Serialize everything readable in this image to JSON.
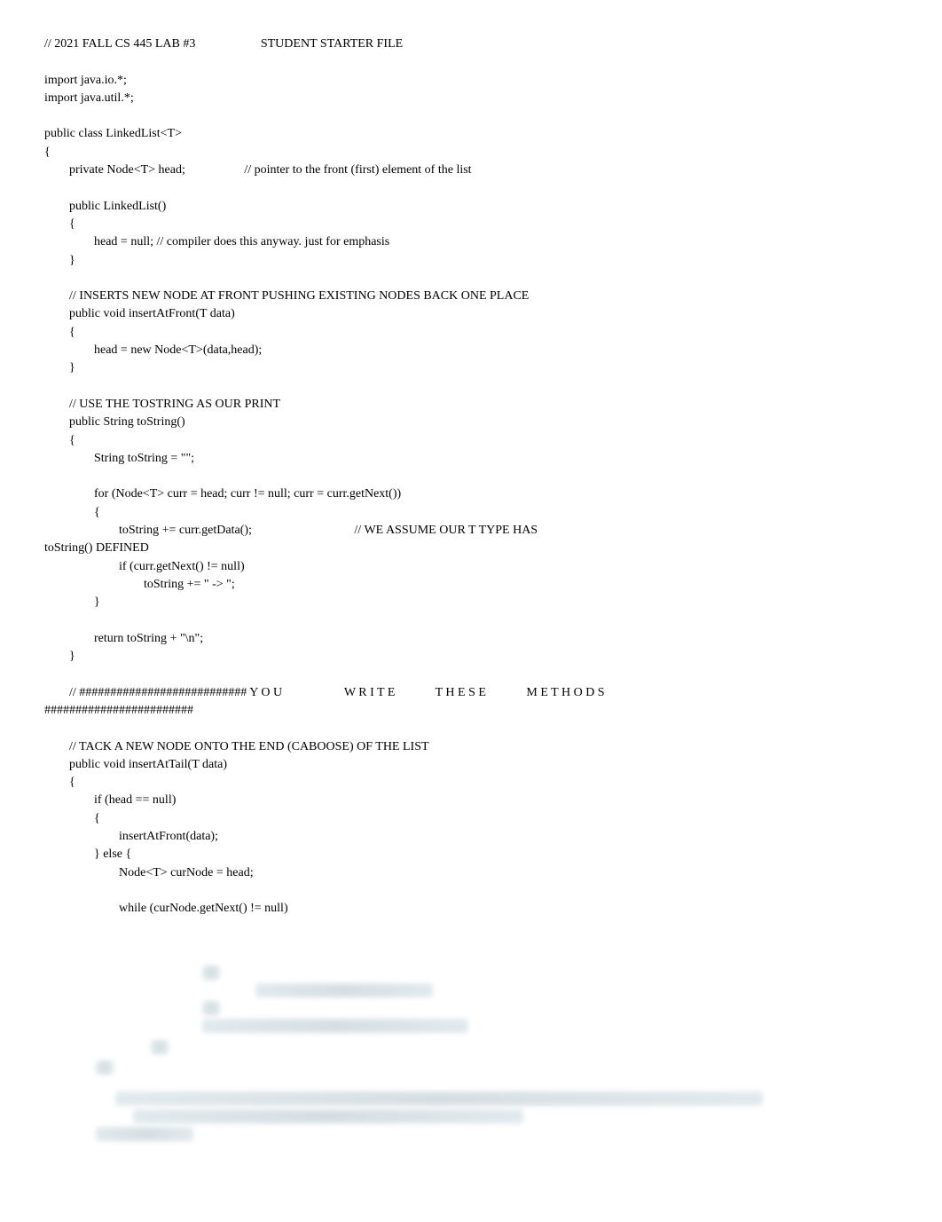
{
  "lines": [
    "// 2021 FALL CS 445 LAB #3                     STUDENT STARTER FILE",
    "",
    "import java.io.*;",
    "import java.util.*;",
    "",
    "public class LinkedList<T>",
    "{",
    "        private Node<T> head;                   // pointer to the front (first) element of the list",
    "",
    "        public LinkedList()",
    "        {",
    "                head = null; // compiler does this anyway. just for emphasis",
    "        }",
    "",
    "        // INSERTS NEW NODE AT FRONT PUSHING EXISTING NODES BACK ONE PLACE",
    "        public void insertAtFront(T data)",
    "        {",
    "                head = new Node<T>(data,head);",
    "        }",
    "",
    "        // USE THE TOSTRING AS OUR PRINT",
    "        public String toString()",
    "        {",
    "                String toString = \"\";",
    "",
    "                for (Node<T> curr = head; curr != null; curr = curr.getNext())",
    "                {",
    "                        toString += curr.getData();                                 // WE ASSUME OUR T TYPE HAS",
    "toString() DEFINED",
    "                        if (curr.getNext() != null)",
    "                                toString += \" -> \";",
    "                }",
    "",
    "                return toString + \"\\n\";",
    "        }",
    "",
    "        // ########################### Y O U                    W R I T E             T H E S E             M E T H O D S",
    "########################",
    "",
    "        // TACK A NEW NODE ONTO THE END (CABOOSE) OF THE LIST",
    "        public void insertAtTail(T data)",
    "        {",
    "                if (head == null)",
    "                {",
    "                        insertAtFront(data);",
    "                } else {",
    "                        Node<T> curNode = head;",
    "",
    "                        while (curNode.getNext() != null)",
    "",
    "",
    "",
    "",
    "",
    "",
    "",
    "",
    "",
    "",
    "",
    ""
  ]
}
